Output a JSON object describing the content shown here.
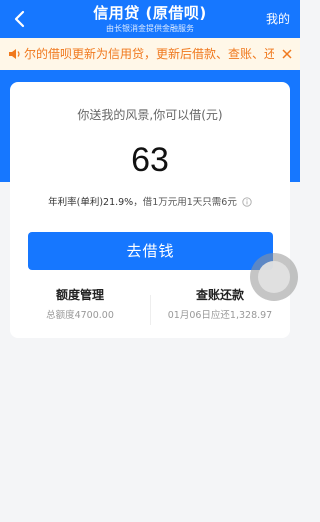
{
  "header": {
    "title": "信用贷 (原借呗)",
    "subtitle": "由长银消金提供金融服务",
    "mine_label": "我的"
  },
  "notice": {
    "text": "尔的借呗更新为信用贷，更新后借款、查账、还"
  },
  "card": {
    "label": "你送我的风景,你可以借(元)",
    "amount": "63",
    "rate_prefix": "年利率(单利)21.9%",
    "rate_suffix": "，借1万元用1天只需6元"
  },
  "borrow_button": "去借钱",
  "quota": {
    "title": "额度管理",
    "sub": "总额度4700.00"
  },
  "bill": {
    "title": "查账还款",
    "sub": "01月06日应还1,328.97"
  },
  "colors": {
    "brand": "#1677ff",
    "notice_text": "#f0791e",
    "notice_bg": "#fff7e8"
  },
  "icons": [
    "back-arrow-icon",
    "speaker-icon",
    "close-icon",
    "info-icon",
    "floating-assistant-ball"
  ]
}
